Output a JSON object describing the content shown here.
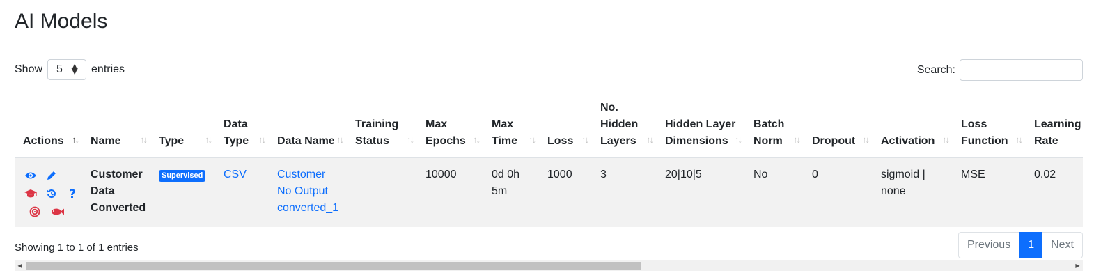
{
  "page": {
    "title": "AI Models"
  },
  "length_control": {
    "show_label": "Show",
    "value": "5",
    "entries_label": "entries"
  },
  "search": {
    "label": "Search:",
    "value": "",
    "placeholder": ""
  },
  "table": {
    "columns": [
      {
        "label": "Actions",
        "width": 97
      },
      {
        "label": "Name",
        "width": 98
      },
      {
        "label": "Type",
        "width": 93
      },
      {
        "label": "Data Type",
        "width": 77
      },
      {
        "label": "Data Name",
        "width": 112
      },
      {
        "label": "Training Status",
        "width": 101
      },
      {
        "label": "Max Epochs",
        "width": 95
      },
      {
        "label": "Max Time",
        "width": 80
      },
      {
        "label": "Loss",
        "width": 76
      },
      {
        "label": "No. Hidden Layers",
        "width": 93
      },
      {
        "label": "Hidden Layer Dimensions",
        "width": 127
      },
      {
        "label": "Batch Norm",
        "width": 84
      },
      {
        "label": "Dropout",
        "width": 99
      },
      {
        "label": "Activation",
        "width": 115
      },
      {
        "label": "Loss Function",
        "width": 105
      },
      {
        "label": "Learning Rate",
        "width": 108
      }
    ],
    "rows": [
      {
        "name": "Customer Data Converted",
        "type": "Supervised",
        "data_type": "CSV",
        "data_name": "Customer No Output converted_1",
        "training_status": "",
        "max_epochs": "10000",
        "max_time": "0d 0h 5m",
        "loss": "1000",
        "no_hidden_layers": "3",
        "hidden_layer_dimensions": "20|10|5",
        "batch_norm": "No",
        "dropout": "0",
        "activation": "sigmoid | none",
        "loss_function": "MSE",
        "learning_rate": "0.02"
      }
    ]
  },
  "row_actions": [
    {
      "name": "view-icon",
      "color": "#0d6efd"
    },
    {
      "name": "edit-icon",
      "color": "#0d6efd"
    },
    {
      "name": "train-icon",
      "color": "#dc3545"
    },
    {
      "name": "history-icon",
      "color": "#0d6efd"
    },
    {
      "name": "help-icon",
      "color": "#0d6efd"
    },
    {
      "name": "target-icon",
      "color": "#dc3545"
    },
    {
      "name": "fish-icon",
      "color": "#dc3545"
    }
  ],
  "footer": {
    "info": "Showing 1 to 1 of 1 entries",
    "pagination": {
      "previous": "Previous",
      "current": "1",
      "next": "Next"
    }
  },
  "colors": {
    "accent": "#0d6efd",
    "danger": "#dc3545",
    "row_bg": "#f2f2f2"
  }
}
